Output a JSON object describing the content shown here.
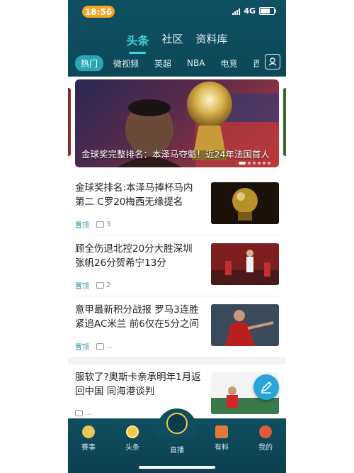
{
  "status_bar": {
    "time": "18:56",
    "network": "4G"
  },
  "main_tabs": [
    {
      "label": "头条",
      "active": true
    },
    {
      "label": "社区",
      "active": false
    },
    {
      "label": "资料库",
      "active": false
    }
  ],
  "sub_tabs": [
    {
      "label": "热门",
      "active": true
    },
    {
      "label": "微视频"
    },
    {
      "label": "英超"
    },
    {
      "label": "NBA"
    },
    {
      "label": "电竞"
    },
    {
      "label": "西甲"
    }
  ],
  "banner": {
    "caption": "金球奖完整排名：本泽马夺魁！近24年法国首人"
  },
  "news": [
    {
      "title": "金球奖排名:本泽马捧杯马内第二 C罗20梅西无缘提名",
      "tag": "置顶",
      "comments": "3",
      "thumb": "golden-ball"
    },
    {
      "title": "顾全伤退北控20分大胜深圳 张帆26分贺希宁13分",
      "tag": "置顶",
      "comments": "2",
      "thumb": "basketball"
    },
    {
      "title": "意甲最新积分战报 罗马3连胜紧追AC米兰 前6仅在5分之间",
      "tag": "置顶",
      "comments": "...",
      "thumb": "soccer-player"
    },
    {
      "title": "服软了?奥斯卡亲承明年1月返回中国 同海港谈判",
      "tag": "",
      "comments": "...",
      "thumb": "oscar"
    }
  ],
  "bottom_nav": [
    {
      "label": "赛事"
    },
    {
      "label": "头条",
      "active": true
    },
    {
      "label": "直播"
    },
    {
      "label": "有料"
    },
    {
      "label": "我的"
    }
  ],
  "colors": {
    "header": "#0f5063",
    "accent": "#3fd1d9",
    "tag": "#2a8fa3",
    "time_pill": "#f5a623"
  }
}
